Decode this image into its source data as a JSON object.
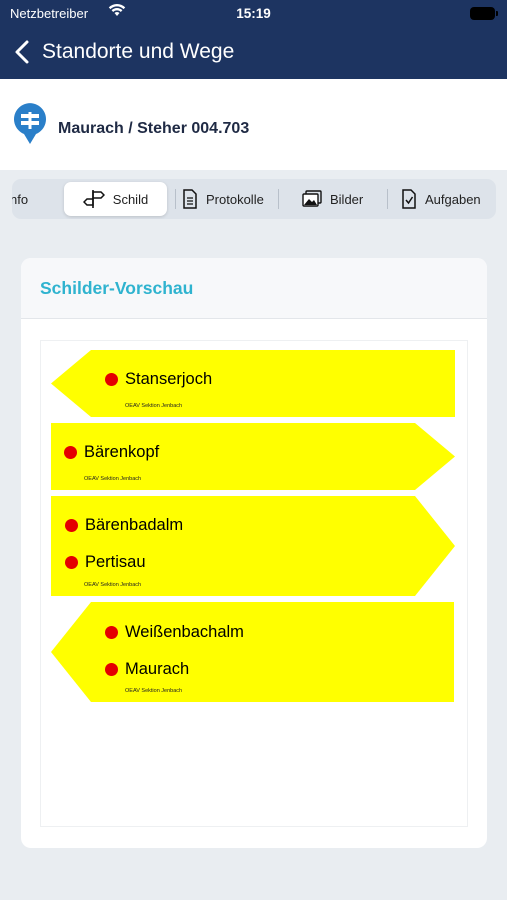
{
  "status_bar": {
    "carrier": "Netzbetreiber",
    "time": "15:19"
  },
  "nav": {
    "title": "Standorte und Wege"
  },
  "location": {
    "title": "Maurach / Steher 004.703"
  },
  "tabs": [
    {
      "label": "Info",
      "icon": "info-icon"
    },
    {
      "label": "Schild",
      "icon": "signpost-icon",
      "selected": true
    },
    {
      "label": "Protokolle",
      "icon": "document-icon"
    },
    {
      "label": "Bilder",
      "icon": "images-icon"
    },
    {
      "label": "Aufgaben",
      "icon": "task-icon"
    }
  ],
  "tab_labels": {
    "info": "nfo",
    "schild": "Schild",
    "protokolle": "Protokolle",
    "bilder": "Bilder",
    "aufgaben": "Aufgaben"
  },
  "card": {
    "title": "Schilder-Vorschau"
  },
  "signs": [
    {
      "direction": "left",
      "destinations": [
        "Stanserjoch"
      ],
      "club": "OEAV Sektion Jenbach"
    },
    {
      "direction": "right",
      "destinations": [
        "Bärenkopf"
      ],
      "club": "OEAV Sektion Jenbach"
    },
    {
      "direction": "right",
      "destinations": [
        "Bärenbadalm",
        "Pertisau"
      ],
      "club": "OEAV Sektion Jenbach"
    },
    {
      "direction": "left",
      "destinations": [
        "Weißenbachalm",
        "Maurach"
      ],
      "club": "OEAV Sektion Jenbach"
    }
  ],
  "colors": {
    "nav_bg": "#1d3461",
    "accent": "#2fb3cf",
    "sign_fill": "#ffff00",
    "dot": "#e40000"
  }
}
